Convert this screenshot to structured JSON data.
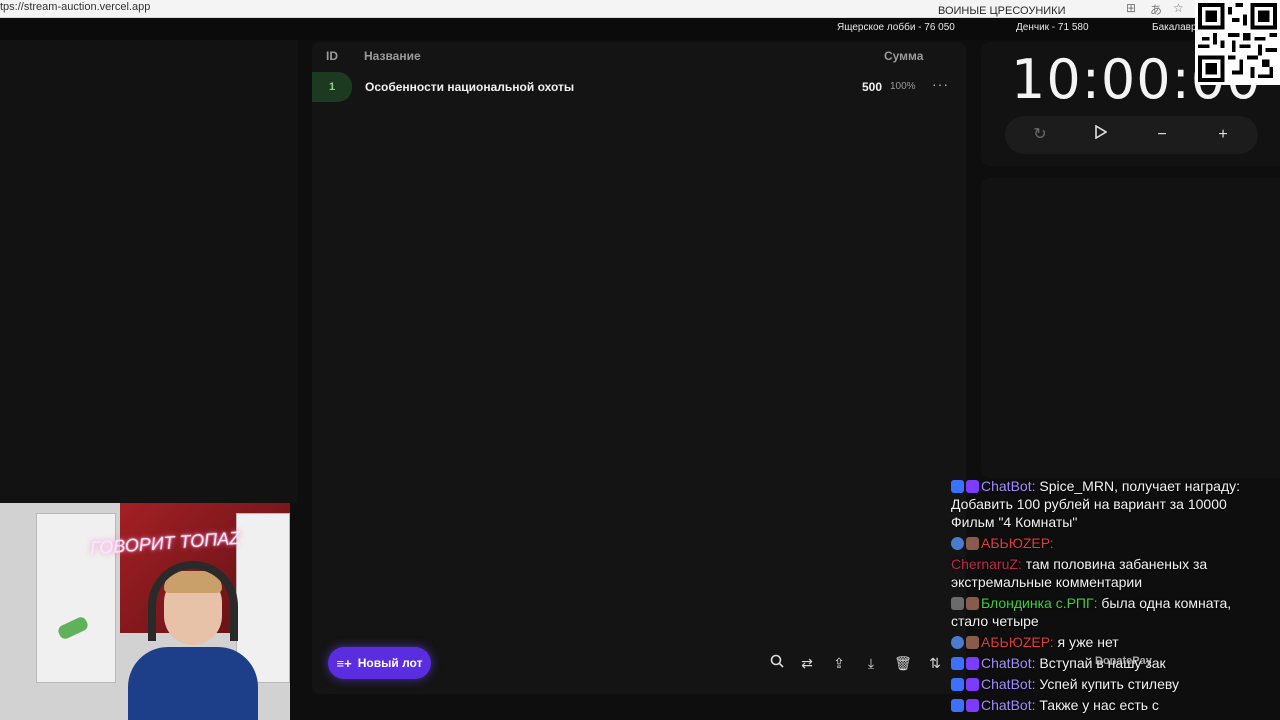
{
  "browser": {
    "url": "tps://stream-auction.vercel.app"
  },
  "ticker": {
    "items": [
      "Ящерское лобби - 76 050",
      "Денчик - 71 580",
      "Бакалавр"
    ]
  },
  "table": {
    "headers": {
      "id": "ID",
      "name": "Название",
      "amount": "Сумма"
    },
    "rows": [
      {
        "id": "1",
        "name": "Особенности национальной охоты",
        "amount": "500",
        "percent": "100%",
        "menu": "···"
      }
    ]
  },
  "new_lot_button": {
    "label": "Новый лот",
    "icon": "playlist-add-icon"
  },
  "toolbar_icons": [
    "search-icon",
    "shuffle-icon",
    "upload-icon",
    "download-icon",
    "trash-icon",
    "sort-icon"
  ],
  "timer": {
    "display": "10:00:00",
    "controls": [
      "reset-icon",
      "play-icon",
      "minus-icon",
      "plus-icon"
    ]
  },
  "chat": {
    "messages": [
      {
        "user": "ChatBot",
        "user_color": "#a58bff",
        "text": "Spice_MRN, получает награду: Добавить 100 рублей на вариант за 10000 Фильм \"4 Комнаты\"",
        "badges": [
          "b-bot",
          "b-bot2"
        ]
      },
      {
        "user": "АБЬЮZЕР",
        "user_color": "#e03c3c",
        "text": "",
        "badges": [
          "b-blue-round",
          "b-brown"
        ]
      },
      {
        "user": "ChernaruZ",
        "user_color": "#c0284a",
        "text": "там половина забаненых за экстремальные комментарии",
        "badges": []
      },
      {
        "user": "Блондинка с.РПГ",
        "user_color": "#3cd13c",
        "text": "была одна комната, стало четыре",
        "badges": [
          "b-grey",
          "b-brown"
        ]
      },
      {
        "user": "АБЬЮZЕР",
        "user_color": "#e03c3c",
        "text": "я уже нет",
        "badges": [
          "b-blue-round",
          "b-brown"
        ]
      },
      {
        "user": "ChatBot",
        "user_color": "#a58bff",
        "text": "Вступай в нашу зак",
        "badges": [
          "b-bot",
          "b-bot2"
        ]
      },
      {
        "user": "ChatBot",
        "user_color": "#a58bff",
        "text": "Успей купить стилеву",
        "badges": [
          "b-bot",
          "b-bot2"
        ]
      },
      {
        "user": "ChatBot",
        "user_color": "#a58bff",
        "text": "Также у нас есть с",
        "badges": [
          "b-bot",
          "b-bot2"
        ]
      }
    ]
  },
  "webcam": {
    "sign_text": "ГОВОРИТ ТОПАZ"
  },
  "donate_watermark": "DonatePay",
  "faint_overlay": "ВОИНЫЕ ЦРЕСОУНИКИ"
}
